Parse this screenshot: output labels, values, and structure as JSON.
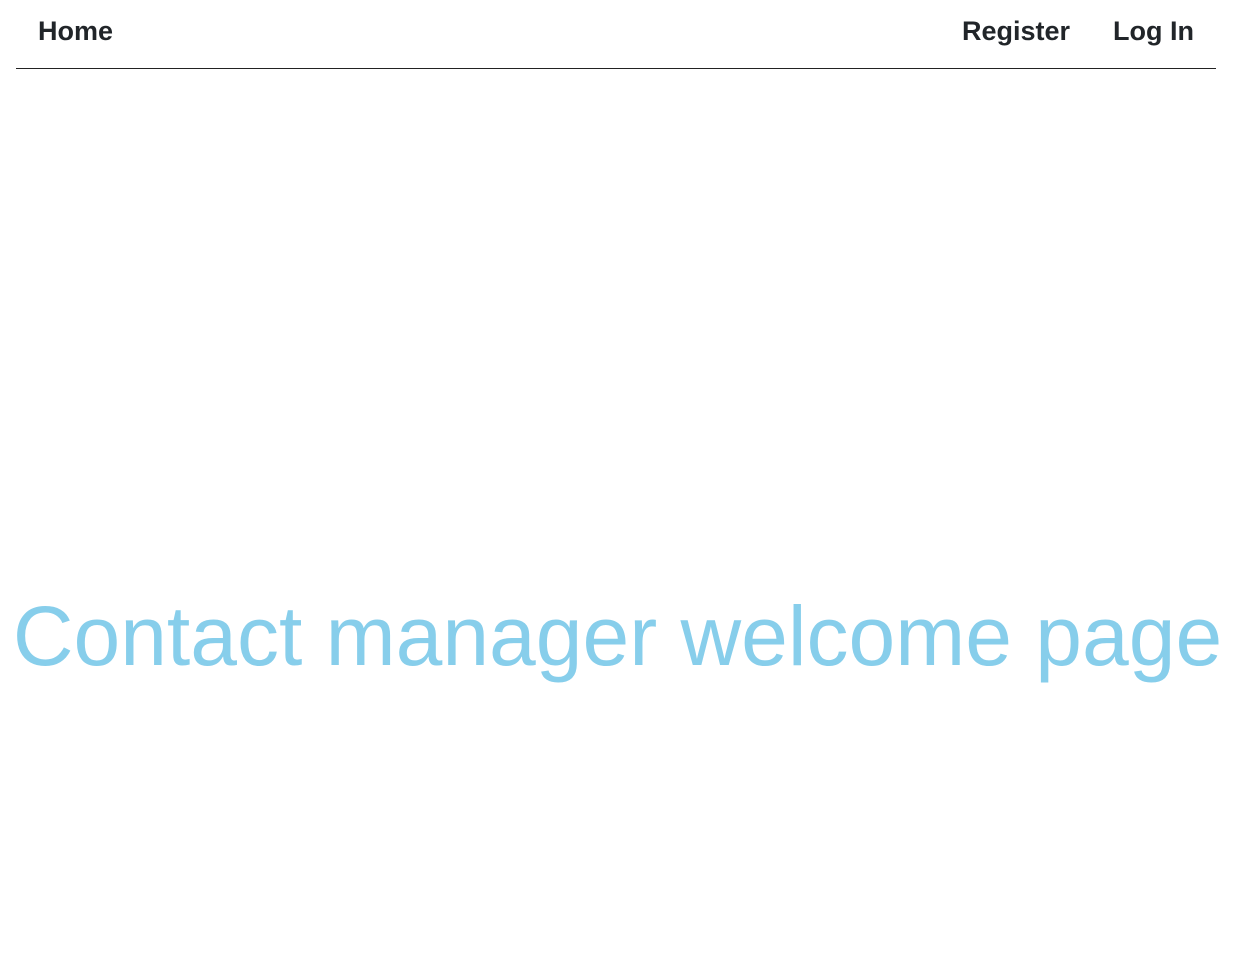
{
  "navbar": {
    "home_label": "Home",
    "register_label": "Register",
    "login_label": "Log In",
    "link_color": "#212529"
  },
  "main": {
    "heading": "Contact manager welcome page",
    "heading_color": "#87ceeb"
  }
}
